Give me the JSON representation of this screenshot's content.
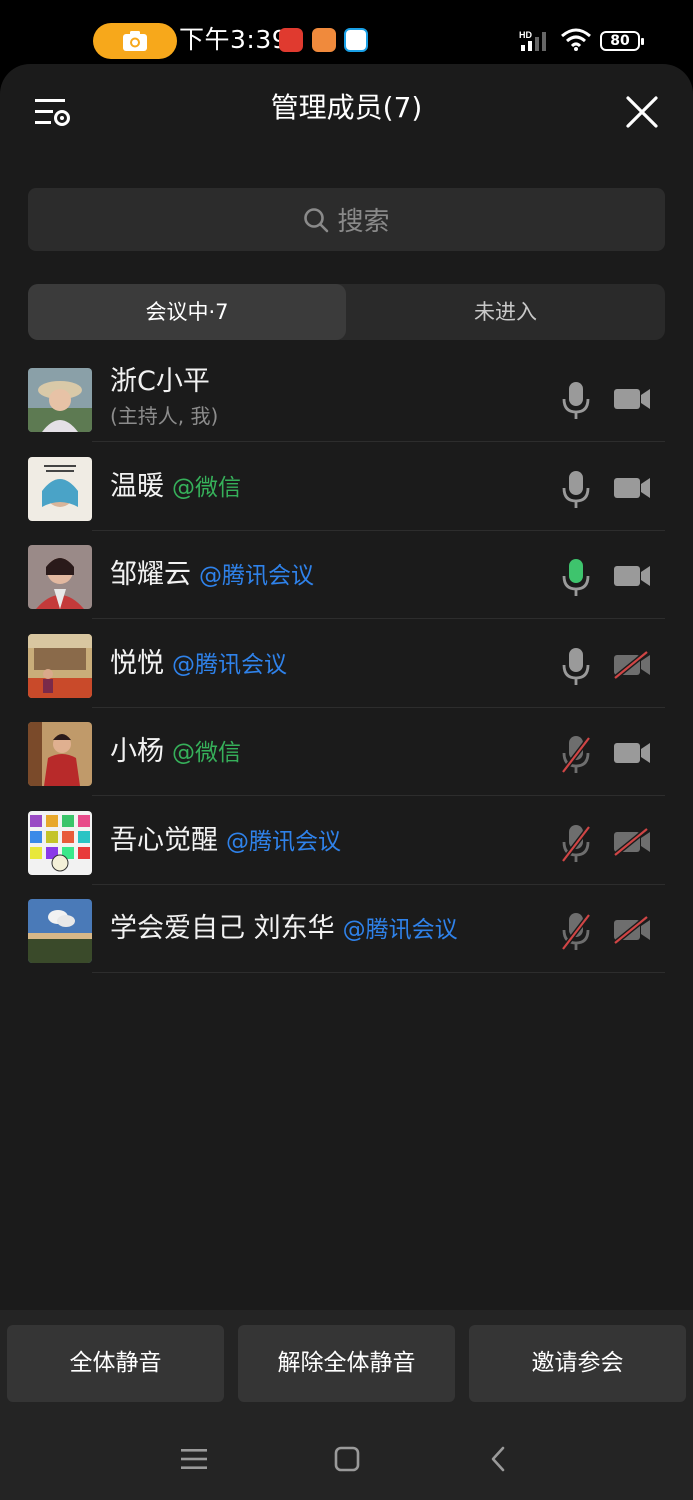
{
  "status_bar": {
    "time": "下午3:39",
    "battery": "80",
    "network": "HD"
  },
  "header": {
    "title": "管理成员(7)"
  },
  "search": {
    "placeholder": "搜索"
  },
  "tabs": [
    {
      "label": "会议中·7",
      "active": true
    },
    {
      "label": "未进入",
      "active": false
    }
  ],
  "members": [
    {
      "name": "浙C小平",
      "subtitle": "(主持人, 我)",
      "tag": "",
      "tag_color": "",
      "mic": "on",
      "camera": "on"
    },
    {
      "name": "温暖",
      "subtitle": "",
      "tag": "@微信",
      "tag_color": "#36b05a",
      "mic": "on",
      "camera": "on"
    },
    {
      "name": "邹耀云",
      "subtitle": "",
      "tag": "@腾讯会议",
      "tag_color": "#2f82ea",
      "mic": "speaking",
      "camera": "on"
    },
    {
      "name": "悦悦",
      "subtitle": "",
      "tag": "@腾讯会议",
      "tag_color": "#2f82ea",
      "mic": "on",
      "camera": "off"
    },
    {
      "name": "小杨",
      "subtitle": "",
      "tag": "@微信",
      "tag_color": "#36b05a",
      "mic": "muted",
      "camera": "on"
    },
    {
      "name": "吾心觉醒",
      "subtitle": "",
      "tag": "@腾讯会议",
      "tag_color": "#2f82ea",
      "mic": "muted",
      "camera": "off"
    },
    {
      "name": "学会爱自己 刘东华",
      "subtitle": "",
      "tag": "@腾讯会议",
      "tag_color": "#2f82ea",
      "mic": "muted",
      "camera": "off"
    }
  ],
  "actions": {
    "mute_all": "全体静音",
    "unmute_all": "解除全体静音",
    "invite": "邀请参会"
  },
  "colors": {
    "speaking_mic": "#3ec46d",
    "off_slash": "#d04545",
    "icon_gray": "#9a9a9a"
  }
}
